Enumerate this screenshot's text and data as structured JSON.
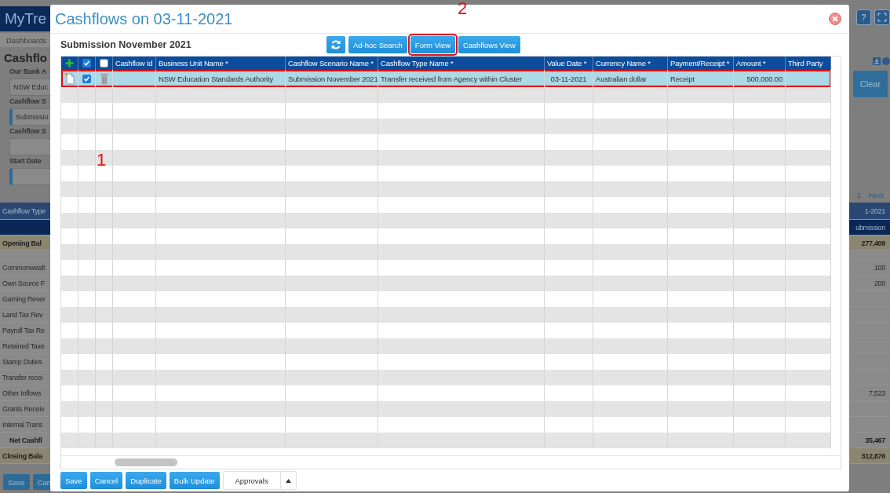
{
  "background": {
    "app_title": "MyTre",
    "nav_item": "Dashboards",
    "page_title": "Cashflo",
    "filters": [
      {
        "label": "Our Bank A",
        "value": "NSW Educ",
        "kind": "input"
      },
      {
        "label": "Cashflow S",
        "value": "Submissio",
        "kind": "picker"
      },
      {
        "label": "Cashflow S",
        "kind": "input"
      },
      {
        "label": "Start Date",
        "kind": "picker"
      }
    ],
    "help_button": "?",
    "clear_button": "Clear",
    "pager": [
      "2",
      "Next"
    ],
    "table": {
      "header": {
        "label": "Cashflow Type",
        "value": "1-2021"
      },
      "subheader": {
        "value": "ubmission"
      },
      "rows": [
        {
          "label": "Opening Bal",
          "value": "277,409",
          "kind": "balance"
        },
        {
          "label": "Commonwealt",
          "value": "100",
          "kind": "item"
        },
        {
          "label": "Own Source F",
          "value": "200",
          "kind": "item"
        },
        {
          "label": "Gaming Rever",
          "kind": "item"
        },
        {
          "label": "Land Tax Rev",
          "kind": "item"
        },
        {
          "label": "Payroll Tax Re",
          "kind": "item"
        },
        {
          "label": "Retained Taxe",
          "kind": "item"
        },
        {
          "label": "Stamp Duties",
          "kind": "item"
        },
        {
          "label": "Transfer recei",
          "kind": "item"
        },
        {
          "label": "Other Inflows",
          "value": "7,523",
          "kind": "item"
        },
        {
          "label": "Grants Receiv",
          "kind": "item"
        },
        {
          "label": "Internal Trans",
          "kind": "item"
        },
        {
          "label": "Net Cashfl",
          "value": "35,467",
          "kind": "total"
        },
        {
          "label": "Closing Bala",
          "value": "312,876",
          "kind": "balance"
        }
      ]
    },
    "buttons": [
      "Save",
      "Can"
    ]
  },
  "modal": {
    "title": "Cashflows on 03-11-2021",
    "subtitle": "Submission November 2021",
    "toolbar": [
      {
        "kind": "refresh"
      },
      {
        "kind": "button",
        "label": "Ad-hoc Search",
        "highlighted": false
      },
      {
        "kind": "button",
        "label": "Form View",
        "highlighted": true
      },
      {
        "kind": "button",
        "label": "Cashflows View",
        "highlighted": false
      }
    ],
    "grid": {
      "header_checks": [
        {
          "checked": true
        },
        {
          "checked": false
        }
      ],
      "columns": [
        {
          "label": "Cashflow Id",
          "kind": "text"
        },
        {
          "label": "Business Unit Name *",
          "kind": "text"
        },
        {
          "label": "Cashflow Scenario Name *",
          "kind": "text"
        },
        {
          "label": "Cashflow Type Name *",
          "kind": "text"
        },
        {
          "label": "Value Date *",
          "kind": "date"
        },
        {
          "label": "Currency Name *",
          "kind": "text"
        },
        {
          "label": "Payment/Receipt *",
          "kind": "text"
        },
        {
          "label": "Amount *",
          "kind": "amount"
        },
        {
          "label": "Third Party",
          "kind": "text"
        }
      ],
      "rows": [
        {
          "selected": true,
          "checked": true,
          "highlighted": true,
          "cells": [
            null,
            "NSW Education Standards Authority",
            "Submission November 2021",
            "Transfer received from Agency within Cluster",
            "03-11-2021",
            "Australian dollar",
            "Receipt",
            "500,000.00",
            null
          ]
        }
      ]
    },
    "footer": [
      {
        "label": "Save",
        "kind": "primary"
      },
      {
        "label": "Cancel",
        "kind": "primary"
      },
      {
        "label": "Duplicate",
        "kind": "primary"
      },
      {
        "label": "Bulk Update",
        "kind": "primary"
      },
      {
        "label": "Approvals",
        "kind": "split"
      }
    ],
    "annotations": [
      {
        "label": "1",
        "kind": "row"
      },
      {
        "label": "2",
        "kind": "button"
      }
    ]
  }
}
